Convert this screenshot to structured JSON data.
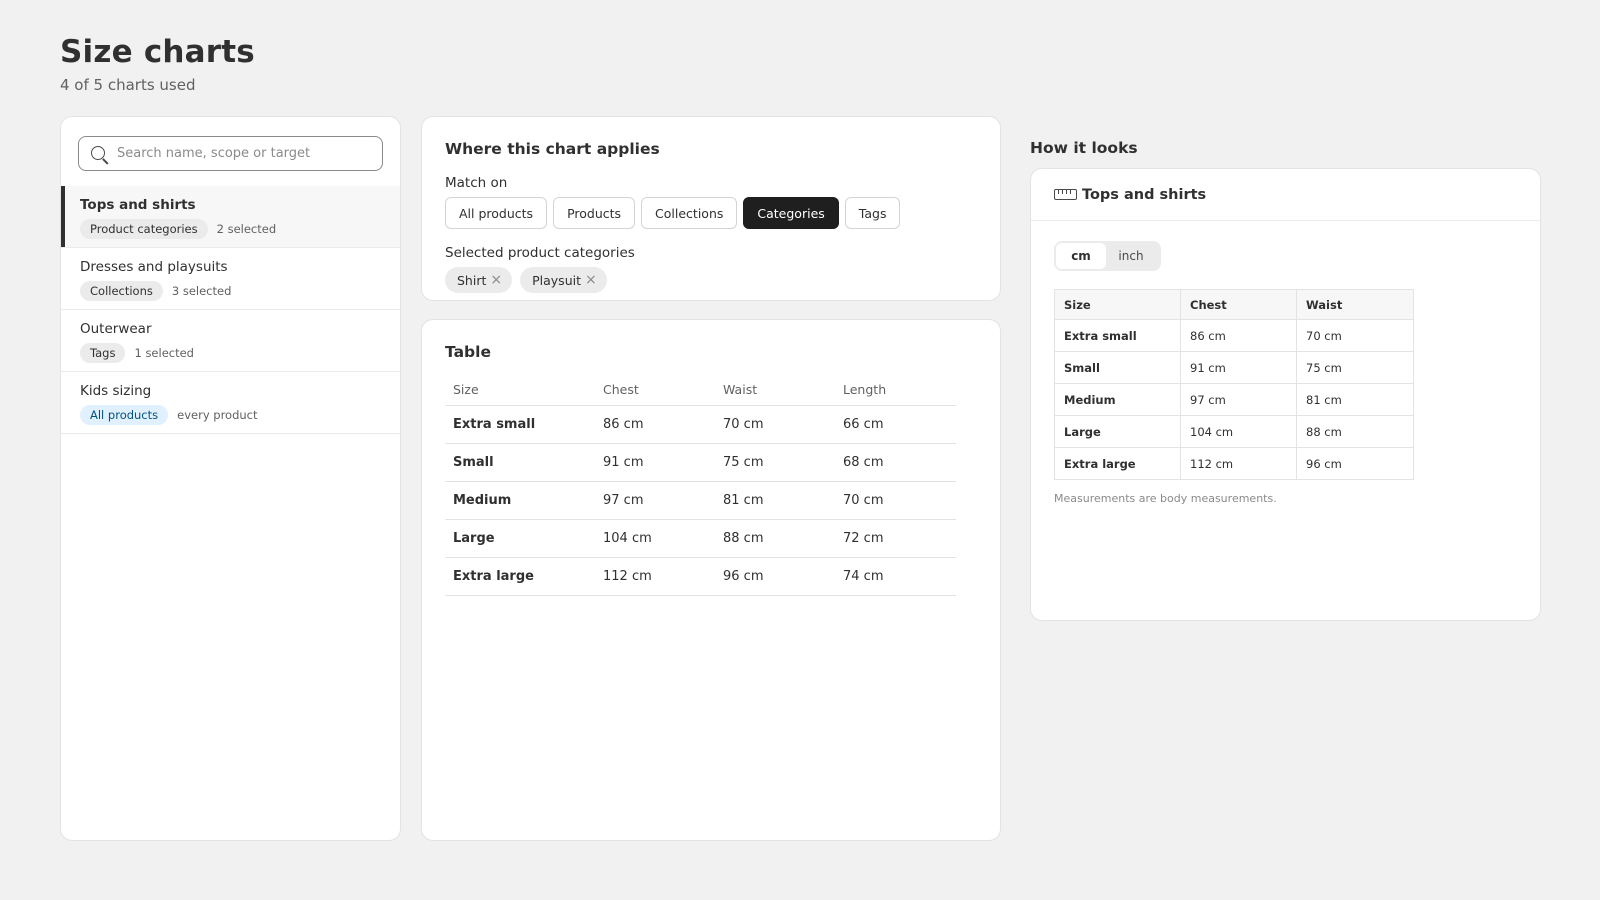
{
  "header": {
    "title": "Size charts",
    "subtitle": "4 of 5 charts used"
  },
  "search": {
    "placeholder": "Search name, scope or target",
    "value": ""
  },
  "charts": [
    {
      "name": "Tops and shirts",
      "scope": "Product categories",
      "meta": "2 selected",
      "active": true
    },
    {
      "name": "Dresses and playsuits",
      "scope": "Collections",
      "meta": "3 selected",
      "active": false
    },
    {
      "name": "Outerwear",
      "scope": "Tags",
      "meta": "1 selected",
      "active": false
    },
    {
      "name": "Kids sizing",
      "scope": "All products",
      "meta": "every product",
      "active": false
    }
  ],
  "applies": {
    "title": "Where this chart applies",
    "match_label": "Match on",
    "match_options": [
      "All products",
      "Products",
      "Collections",
      "Categories",
      "Tags"
    ],
    "selected_option": "Categories",
    "selected_label": "Selected product categories",
    "selected_items": [
      "Shirt",
      "Playsuit"
    ]
  },
  "table": {
    "title": "Table",
    "columns": [
      "Size",
      "Chest",
      "Waist",
      "Length"
    ],
    "rows": [
      [
        "Extra small",
        "86 cm",
        "70 cm",
        "66 cm"
      ],
      [
        "Small",
        "91 cm",
        "75 cm",
        "68 cm"
      ],
      [
        "Medium",
        "97 cm",
        "81 cm",
        "70 cm"
      ],
      [
        "Large",
        "104 cm",
        "88 cm",
        "72 cm"
      ],
      [
        "Extra large",
        "112 cm",
        "96 cm",
        "74 cm"
      ]
    ]
  },
  "preview": {
    "heading": "How it looks",
    "chart_title": "Tops and shirts",
    "units": [
      "cm",
      "inch"
    ],
    "selected_unit": "cm",
    "columns": [
      "Size",
      "Chest",
      "Waist"
    ],
    "rows": [
      [
        "Extra small",
        "86 cm",
        "70 cm"
      ],
      [
        "Small",
        "91 cm",
        "75 cm"
      ],
      [
        "Medium",
        "97 cm",
        "81 cm"
      ],
      [
        "Large",
        "104 cm",
        "88 cm"
      ],
      [
        "Extra large",
        "112 cm",
        "96 cm"
      ]
    ],
    "note": "Measurements are body measurements."
  },
  "colors": {
    "background": "#f1f1f1",
    "selected_button": "#1f1f1f",
    "all_products_pill": "#e0f0ff"
  }
}
